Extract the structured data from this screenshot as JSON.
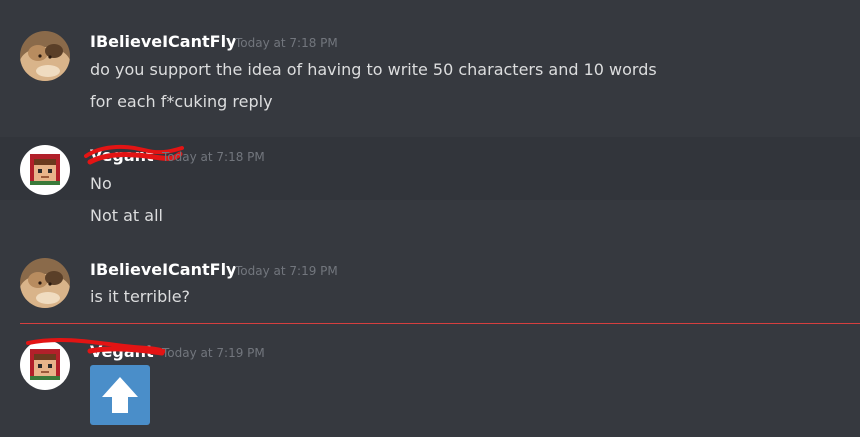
{
  "colors": {
    "background": "#36393f",
    "hover_background": "#32353b",
    "username": "#ffffff",
    "message_text": "#dcddde",
    "timestamp": "#72767d",
    "new_divider": "#d63f3f",
    "redaction": "#e31414",
    "upvote_tile": "#4a8ec9"
  },
  "messages": [
    {
      "author": "IBelieveICantFly",
      "timestamp": "Today at 7:18 PM",
      "avatar": "cat-avatar",
      "lines": [
        "do you support the idea of having to write 50 characters and 10 words",
        "for each f*cuking reply"
      ]
    },
    {
      "author": "Vegant",
      "author_redacted": true,
      "timestamp": "Today at 7:18 PM",
      "avatar": "pixel-character-avatar",
      "lines": [
        "No",
        "Not at all"
      ]
    },
    {
      "author": "IBelieveICantFly",
      "timestamp": "Today at 7:19 PM",
      "avatar": "cat-avatar",
      "lines": [
        "is it terrible?"
      ]
    },
    {
      "author": "Vegant",
      "author_redacted": true,
      "timestamp": "Today at 7:19 PM",
      "avatar": "pixel-character-avatar",
      "attachment": "arrow-up-emoji"
    }
  ]
}
